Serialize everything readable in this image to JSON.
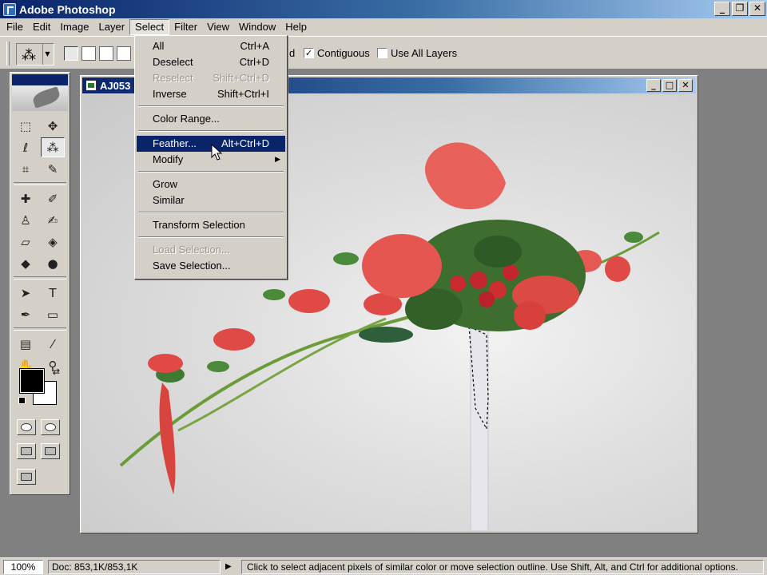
{
  "app": {
    "title": "Adobe Photoshop"
  },
  "window_buttons": {
    "minimize": "_",
    "restore": "❐",
    "close": "✕"
  },
  "menubar": {
    "items": [
      {
        "label": "File"
      },
      {
        "label": "Edit"
      },
      {
        "label": "Image"
      },
      {
        "label": "Layer"
      },
      {
        "label": "Select"
      },
      {
        "label": "Filter"
      },
      {
        "label": "View"
      },
      {
        "label": "Window"
      },
      {
        "label": "Help"
      }
    ],
    "active_index": 4
  },
  "options": {
    "tolerance_tail": "d",
    "contiguous_label": "Contiguous",
    "contiguous_checked": "✓",
    "use_all_layers_label": "Use All Layers"
  },
  "document": {
    "title": "AJ053",
    "buttons": {
      "minimize": "_",
      "maximize": "□",
      "close": "✕"
    }
  },
  "select_menu": {
    "items": [
      {
        "label": "All",
        "shortcut": "Ctrl+A",
        "state": "enabled"
      },
      {
        "label": "Deselect",
        "shortcut": "Ctrl+D",
        "state": "enabled"
      },
      {
        "label": "Reselect",
        "shortcut": "Shift+Ctrl+D",
        "state": "disabled"
      },
      {
        "label": "Inverse",
        "shortcut": "Shift+Ctrl+I",
        "state": "enabled"
      },
      {
        "label": "Color Range...",
        "shortcut": "",
        "state": "enabled"
      },
      {
        "label": "Feather...",
        "shortcut": "Alt+Ctrl+D",
        "state": "highlighted"
      },
      {
        "label": "Modify",
        "shortcut": "",
        "state": "submenu"
      },
      {
        "label": "Grow",
        "shortcut": "",
        "state": "enabled"
      },
      {
        "label": "Similar",
        "shortcut": "",
        "state": "enabled"
      },
      {
        "label": "Transform Selection",
        "shortcut": "",
        "state": "enabled"
      },
      {
        "label": "Load Selection...",
        "shortcut": "",
        "state": "disabled"
      },
      {
        "label": "Save Selection...",
        "shortcut": "",
        "state": "enabled"
      }
    ]
  },
  "status": {
    "zoom": "100%",
    "doc_size": "Doc: 853,1K/853,1K",
    "message": "Click to select adjacent pixels of similar color or move selection outline.  Use Shift, Alt, and Ctrl for additional options."
  },
  "colors": {
    "foreground": "#000000",
    "background": "#ffffff",
    "title_bar": "#0a246a",
    "menu_highlight": "#0a246a"
  }
}
